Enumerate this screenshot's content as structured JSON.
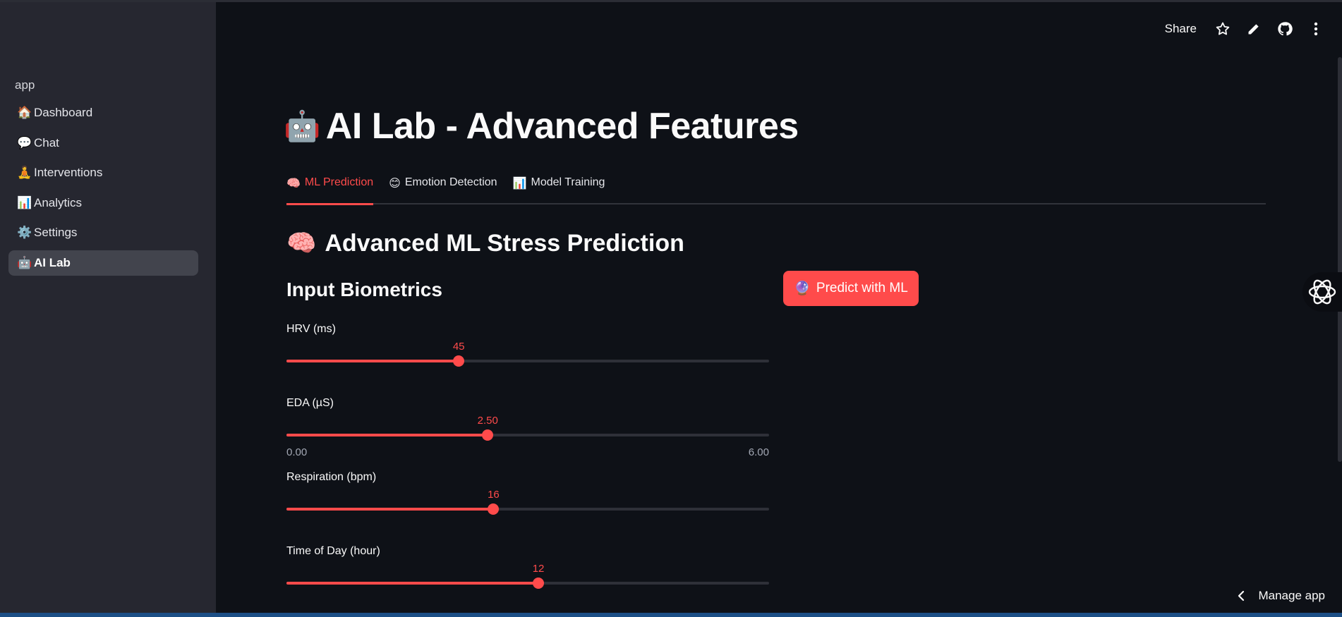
{
  "sidebar": {
    "app_name": "app",
    "items": [
      {
        "emoji": "🏠",
        "label": "Dashboard"
      },
      {
        "emoji": "💬",
        "label": "Chat"
      },
      {
        "emoji": "🧘",
        "label": "Interventions"
      },
      {
        "emoji": "📊",
        "label": "Analytics"
      },
      {
        "emoji": "⚙️",
        "label": "Settings"
      },
      {
        "emoji": "🤖",
        "label": "AI Lab"
      }
    ],
    "active_index": 5
  },
  "header": {
    "share_label": "Share",
    "icons": [
      "star-icon",
      "edit-icon",
      "github-icon",
      "more-vertical-icon"
    ]
  },
  "page": {
    "title_emoji": "🤖",
    "title": "AI Lab - Advanced Features"
  },
  "tabs": [
    {
      "emoji": "🧠",
      "label": "ML Prediction"
    },
    {
      "emoji": "😊",
      "label": "Emotion Detection"
    },
    {
      "emoji": "📊",
      "label": "Model Training"
    }
  ],
  "active_tab": 0,
  "section": {
    "emoji": "🧠",
    "title": "Advanced ML Stress Prediction",
    "subtitle": "Input Biometrics"
  },
  "sliders": [
    {
      "label": "HRV (ms)",
      "value": "45",
      "fraction": 0.357
    },
    {
      "label": "EDA (µS)",
      "value": "2.50",
      "fraction": 0.417,
      "min": "0.00",
      "max": "6.00"
    },
    {
      "label": "Respiration (bpm)",
      "value": "16",
      "fraction": 0.429
    },
    {
      "label": "Time of Day (hour)",
      "value": "12",
      "fraction": 0.522
    }
  ],
  "predict_button": {
    "emoji": "🔮",
    "label": "Predict with ML"
  },
  "footer": {
    "manage_label": "Manage app"
  },
  "colors": {
    "accent": "#ff4b4b",
    "background": "#0e1117",
    "sidebar": "#262730"
  }
}
